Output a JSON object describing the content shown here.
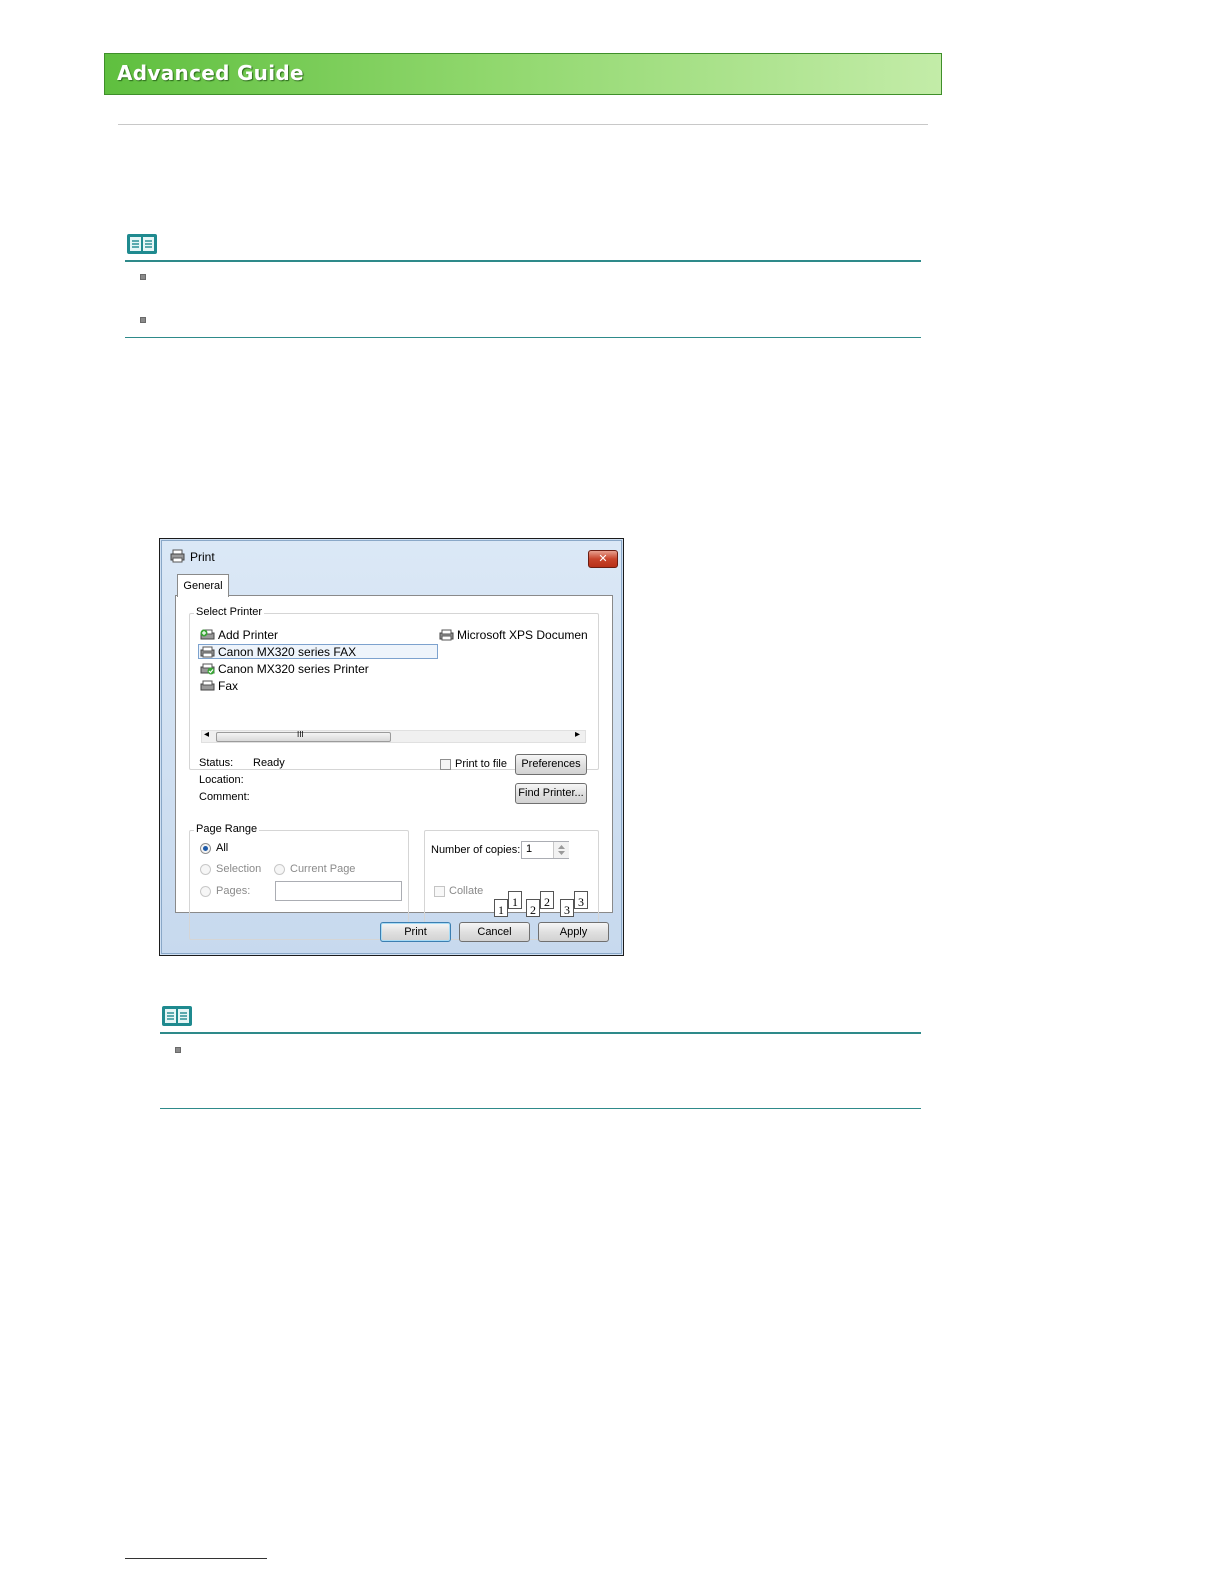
{
  "header": {
    "title": "Advanced Guide"
  },
  "dialog": {
    "title": "Print",
    "close_glyph": "✕",
    "tab": "General",
    "select_printer": {
      "legend": "Select Printer",
      "printers": [
        {
          "name": "Add Printer",
          "icon": "add-printer-icon"
        },
        {
          "name": "Canon MX320 series FAX",
          "icon": "fax-printer-icon",
          "selected": true
        },
        {
          "name": "Canon MX320 series Printer",
          "icon": "default-printer-icon"
        },
        {
          "name": "Fax",
          "icon": "fax-icon"
        },
        {
          "name": "Microsoft XPS Documen",
          "icon": "printer-icon"
        }
      ],
      "scroll_left": "◂",
      "scroll_right": "▸",
      "scroll_grip": "III",
      "status_label": "Status:",
      "status_value": "Ready",
      "location_label": "Location:",
      "comment_label": "Comment:",
      "print_to_file": "Print to file",
      "preferences": "Preferences",
      "find_printer": "Find Printer..."
    },
    "page_range": {
      "legend": "Page Range",
      "all": "All",
      "selection": "Selection",
      "current_page": "Current Page",
      "pages": "Pages:",
      "selected": "All"
    },
    "copies": {
      "label": "Number of copies:",
      "value": "1",
      "collate": "Collate",
      "collate_pages": [
        "1",
        "1",
        "2",
        "2",
        "3",
        "3"
      ]
    },
    "buttons": {
      "print": "Print",
      "cancel": "Cancel",
      "apply": "Apply"
    }
  },
  "colors": {
    "banner_green": "#6cc64a",
    "note_teal": "#2e8a8a"
  }
}
